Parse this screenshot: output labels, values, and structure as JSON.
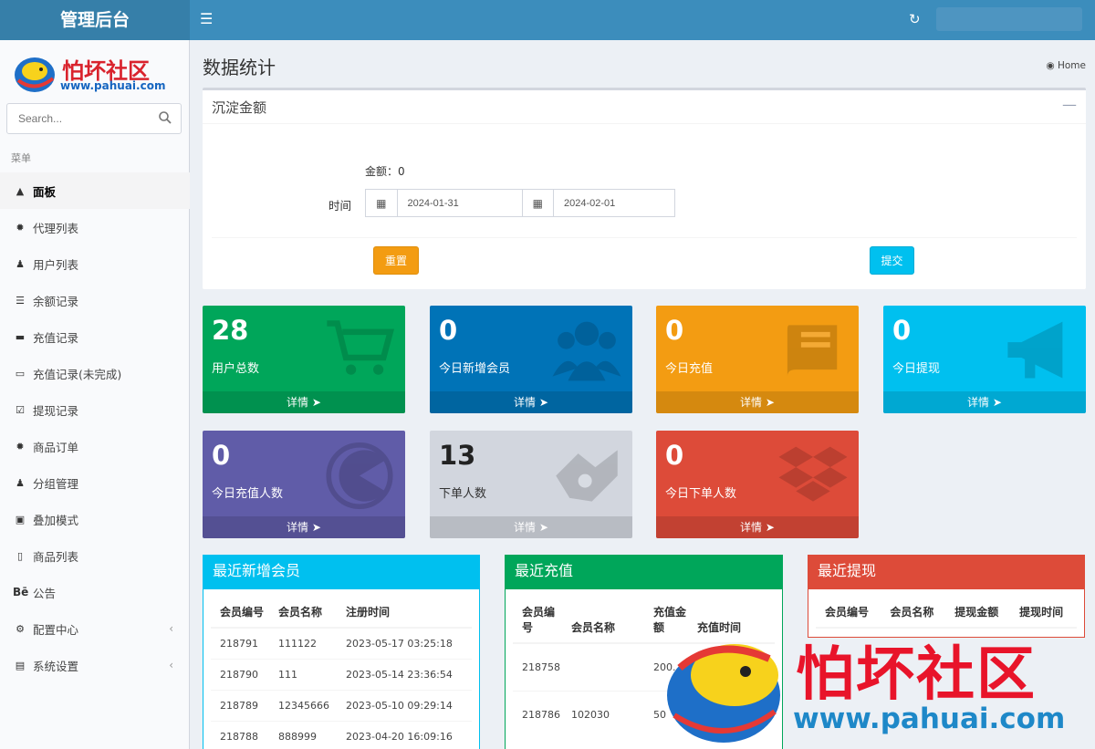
{
  "header": {
    "brand": "管理后台",
    "menu_icon": "bars-icon",
    "refresh_icon": "refresh-icon"
  },
  "sidebar": {
    "logo_text": "怕坏社区",
    "logo_url": "www.pahuai.com",
    "search_placeholder": "Search...",
    "menu_header": "菜单",
    "items": [
      {
        "label": "面板",
        "icon": "dashboard-icon"
      },
      {
        "label": "代理列表",
        "icon": "cog-icon"
      },
      {
        "label": "用户列表",
        "icon": "user-icon"
      },
      {
        "label": "余额记录",
        "icon": "list-icon"
      },
      {
        "label": "充值记录",
        "icon": "card-icon"
      },
      {
        "label": "充值记录(未完成)",
        "icon": "card-outline-icon"
      },
      {
        "label": "提现记录",
        "icon": "check-square-icon"
      },
      {
        "label": "商品订单",
        "icon": "cog-icon"
      },
      {
        "label": "分组管理",
        "icon": "users-icon"
      },
      {
        "label": "叠加模式",
        "icon": "desktop-icon"
      },
      {
        "label": "商品列表",
        "icon": "bar-icon"
      },
      {
        "label": "公告",
        "icon": "behance-icon"
      },
      {
        "label": "配置中心",
        "icon": "cog-outline-icon"
      },
      {
        "label": "系统设置",
        "icon": "server-icon"
      }
    ]
  },
  "page": {
    "title": "数据统计",
    "breadcrumb": "Home"
  },
  "deposit_box": {
    "title": "沉淀金额",
    "amount_label": "金额：",
    "amount_value": "0",
    "time_label": "时间",
    "date_start": "2024-01-31",
    "date_end": "2024-02-01",
    "reset_label": "重置",
    "submit_label": "提交"
  },
  "tiles": [
    {
      "value": "28",
      "label": "用户总数",
      "more": "详情",
      "color": "#00a65a",
      "icon": "cart-icon"
    },
    {
      "value": "0",
      "label": "今日新增会员",
      "more": "详情",
      "color": "#0073b7",
      "icon": "users-icon"
    },
    {
      "value": "0",
      "label": "今日充值",
      "more": "详情",
      "color": "#f39c12",
      "icon": "book-icon"
    },
    {
      "value": "0",
      "label": "今日提现",
      "more": "详情",
      "color": "#00c0ef",
      "icon": "megaphone-icon"
    },
    {
      "value": "0",
      "label": "今日充值人数",
      "more": "详情",
      "color": "#605ca8",
      "icon": "pacman-icon"
    },
    {
      "value": "13",
      "label": "下单人数",
      "more": "详情",
      "color": "#d2d6de",
      "icon": "handshake-icon"
    },
    {
      "value": "0",
      "label": "今日下单人数",
      "more": "详情",
      "color": "#dd4b39",
      "icon": "dropbox-icon"
    }
  ],
  "panels": {
    "new_members": {
      "title": "最近新增会员",
      "columns": [
        "会员编号",
        "会员名称",
        "注册时间"
      ],
      "rows": [
        [
          "218791",
          "111122",
          "2023-05-17 03:25:18"
        ],
        [
          "218790",
          "111",
          "2023-05-14 23:36:54"
        ],
        [
          "218789",
          "12345666",
          "2023-05-10 09:29:14"
        ],
        [
          "218788",
          "888999",
          "2023-04-20 16:09:16"
        ]
      ]
    },
    "recharge": {
      "title": "最近充值",
      "columns": [
        "会员编号",
        "会员名称",
        "充值金额",
        "充值时间"
      ],
      "rows": [
        [
          "218758",
          "",
          "200.",
          ""
        ],
        [
          "218786",
          "102030",
          "50",
          ""
        ]
      ]
    },
    "withdraw": {
      "title": "最近提现",
      "columns": [
        "会员编号",
        "会员名称",
        "提现金额",
        "提现时间"
      ],
      "rows": []
    }
  },
  "watermark": {
    "text": "怕坏社区",
    "url": "www.pahuai.com"
  }
}
